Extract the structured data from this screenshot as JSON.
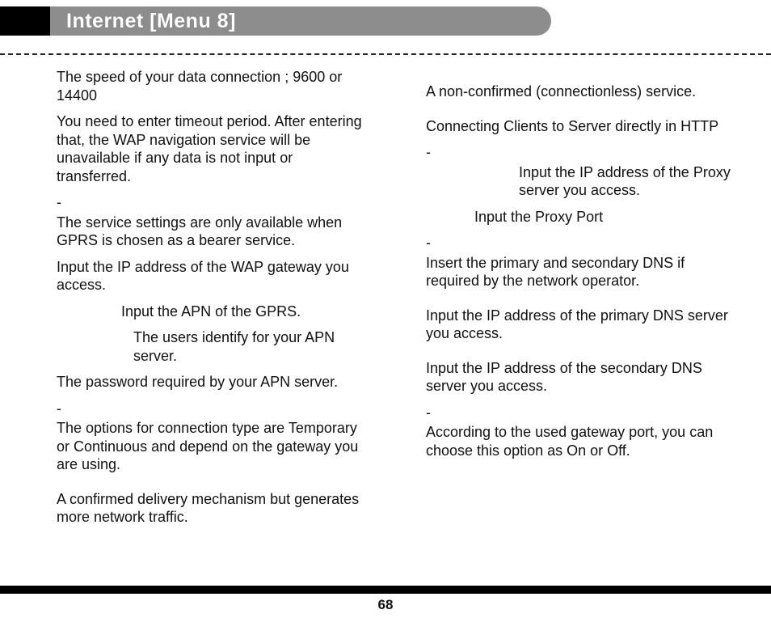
{
  "header": {
    "title": "Internet [Menu 8]"
  },
  "page_number": "68",
  "left": {
    "speed": "The speed of your data connection ; 9600 or 14400",
    "timeout": "You need to enter timeout period. After entering that, the WAP navigation service will be unavailable if any data is not input or transferred.",
    "dash1": "-",
    "gprs_only": "The service settings are only available when GPRS is chosen as a bearer service.",
    "wap_ip": "Input the IP address of the WAP gateway you access.",
    "apn": "Input the APN of the GPRS.",
    "user_id": "The users identify for your APN server.",
    "password": "The password required by your APN server.",
    "dash2": "-",
    "conn_type": "The options for connection type are Temporary or Continuous and depend on the gateway you are using.",
    "confirmed": "A confirmed delivery mechanism but generates more network traffic."
  },
  "right": {
    "non_confirmed": "A non-confirmed (connectionless) service.",
    "http": "Connecting Clients to Server directly in HTTP",
    "dash1": "-",
    "proxy_ip": "Input the IP address of the Proxy server you access.",
    "proxy_port": "Input the Proxy Port",
    "dash2": "-",
    "dns_intro": "Insert the primary and secondary DNS if required by the network operator.",
    "primary_dns": "Input the IP address of the primary DNS server you access.",
    "secondary_dns": "Input the IP address of the secondary DNS server you access.",
    "dash3": "-",
    "secure": "According to the used gateway port, you can choose this option as On or Off."
  }
}
